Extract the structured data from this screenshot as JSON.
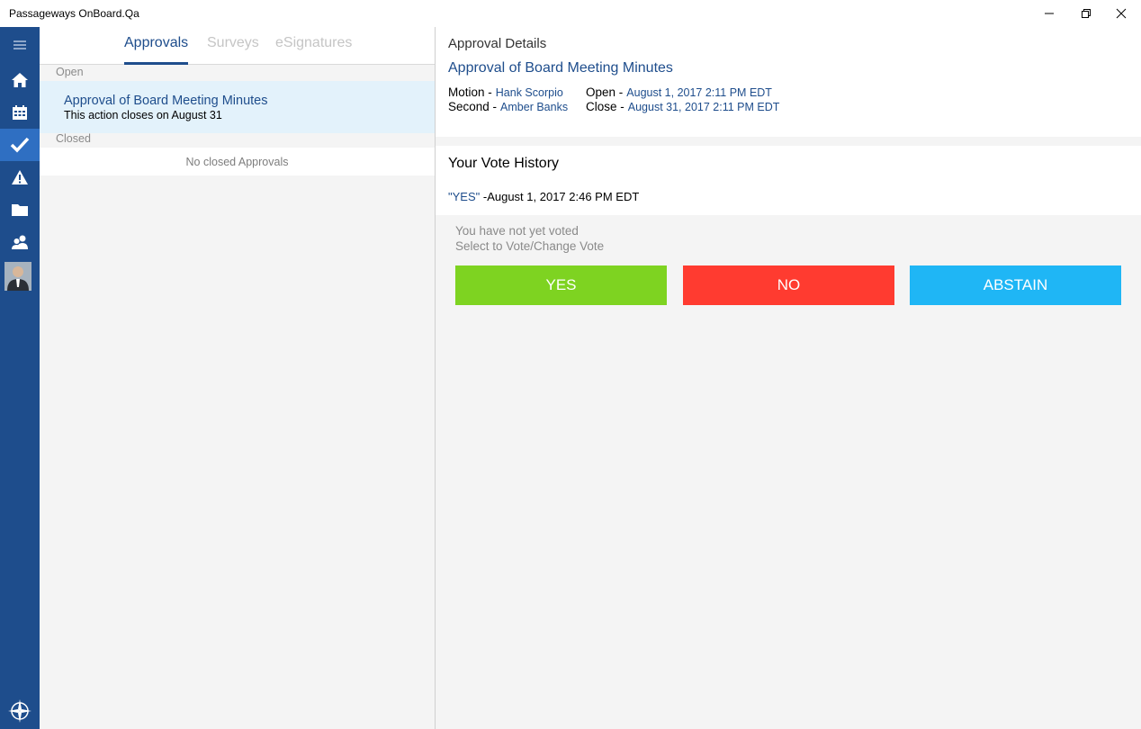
{
  "window": {
    "title": "Passageways OnBoard.Qa"
  },
  "sidebar": {
    "items": [
      {
        "icon": "hamburger-menu-icon"
      },
      {
        "icon": "home-icon"
      },
      {
        "icon": "calendar-icon"
      },
      {
        "icon": "checkmark-icon",
        "active": true
      },
      {
        "icon": "warning-icon"
      },
      {
        "icon": "folder-icon"
      },
      {
        "icon": "people-icon"
      },
      {
        "icon": "avatar"
      }
    ],
    "accent": "#1e4d8c",
    "active_color": "#2f6fc2"
  },
  "tabs": [
    {
      "label": "Approvals",
      "active": true
    },
    {
      "label": "Surveys",
      "active": false
    },
    {
      "label": "eSignatures",
      "active": false
    }
  ],
  "list": {
    "open_label": "Open",
    "open_items": [
      {
        "title": "Approval of Board Meeting Minutes",
        "subtitle": "This action closes on August 31"
      }
    ],
    "closed_label": "Closed",
    "closed_empty": "No closed Approvals"
  },
  "details": {
    "header": "Approval Details",
    "title": "Approval of Board Meeting Minutes",
    "motion_label": "Motion -",
    "motion_value": "Hank Scorpio",
    "second_label": "Second -",
    "second_value": "Amber Banks",
    "open_label": "Open -",
    "open_value": "August 1, 2017 2:11 PM EDT",
    "close_label": "Close -",
    "close_value": "August 31, 2017 2:11 PM EDT"
  },
  "history": {
    "header": "Your Vote History",
    "vote": "\"YES\"",
    "vote_time": " -August 1, 2017 2:46 PM EDT"
  },
  "voting": {
    "status": "You have not yet voted",
    "prompt": "Select to Vote/Change Vote",
    "buttons": [
      {
        "label": "YES",
        "color": "#7ed321"
      },
      {
        "label": "NO",
        "color": "#ff3b30"
      },
      {
        "label": "ABSTAIN",
        "color": "#1fb6f5"
      }
    ]
  }
}
